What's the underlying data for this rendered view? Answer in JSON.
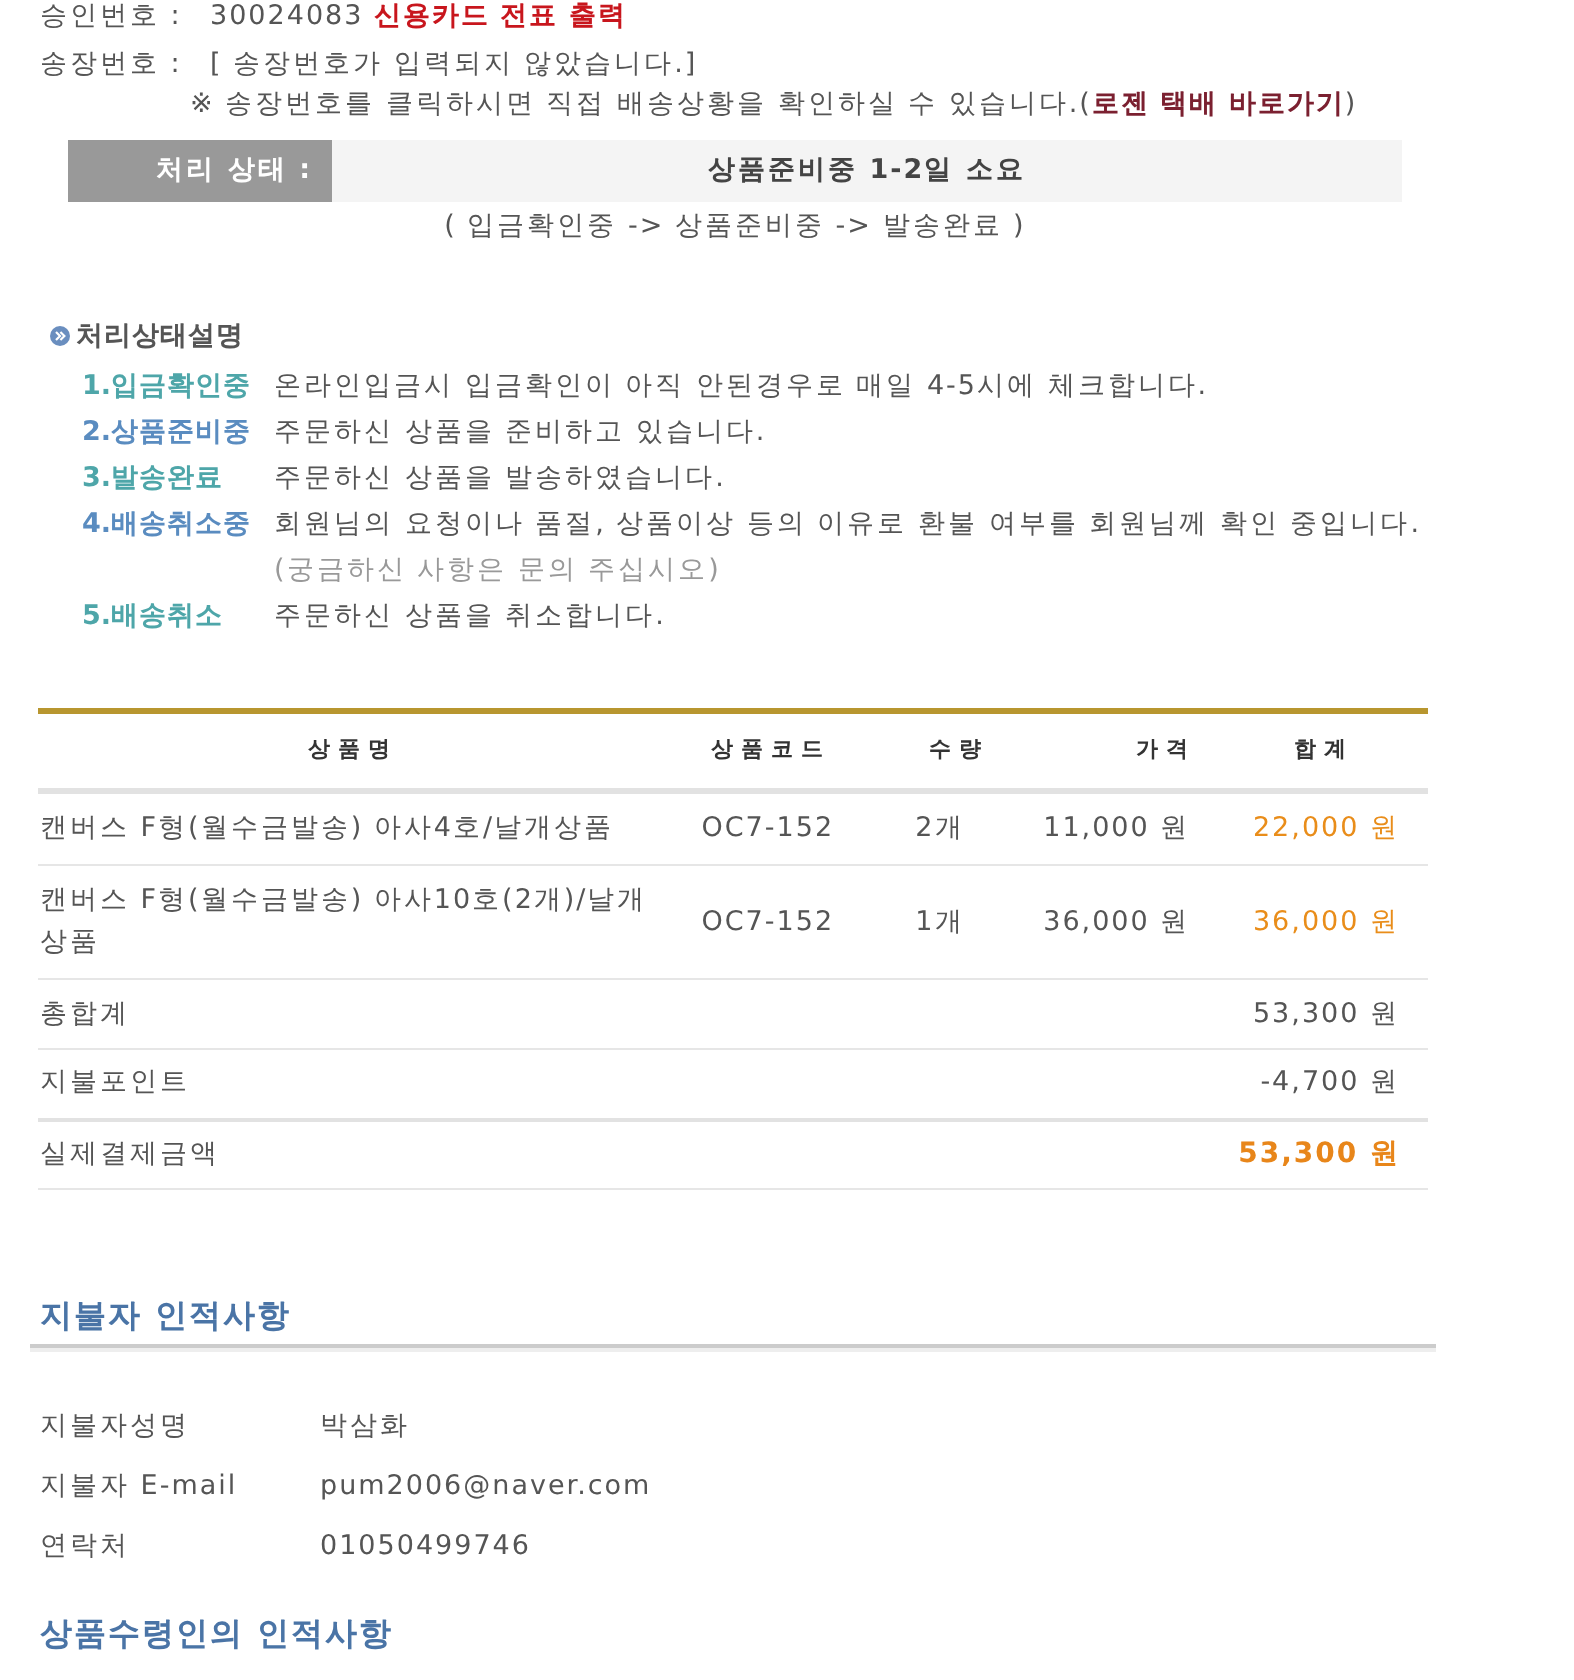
{
  "approval": {
    "label": "승인번호 :",
    "number": "30024083",
    "receipt_link": "신용카드 전표 출력"
  },
  "invoice": {
    "label": "송장번호 :",
    "value": "[ 송장번호가 입력되지 않았습니다.]",
    "note": "※ 송장번호를 클릭하시면 직접 배송상황을 확인하실 수 있습니다.(",
    "courier_link": "로젠 택배 바로가기",
    "note_end": ")"
  },
  "status": {
    "label": "처리 상태 :",
    "value": "상품준비중 1-2일 소요",
    "flow": "( 입금확인중 -> 상품준비중 -> 발송완료 )"
  },
  "status_legend": {
    "title": "처리상태설명",
    "items": [
      {
        "label": "1.입금확인중",
        "color": "#4ea6a9",
        "description": "온라인입금시 입금확인이 아직 안된경우로 매일 4-5시에 체크합니다."
      },
      {
        "label": "2.상품준비중",
        "color": "#5a8cc0",
        "description": "주문하신 상품을 준비하고 있습니다."
      },
      {
        "label": "3.발송완료",
        "color": "#4ea6a9",
        "description": "주문하신 상품을 발송하였습니다."
      },
      {
        "label": "4.배송취소중",
        "color": "#5a8cc0",
        "description": "회원님의 요청이나 품절, 상품이상 등의 이유로 환불 여부를 회원님께 확인 중입니다.",
        "note": "(궁금하신 사항은 문의 주십시오)"
      },
      {
        "label": "5.배송취소",
        "color": "#4ea6a9",
        "description": "주문하신 상품을 취소합니다."
      }
    ]
  },
  "order_table": {
    "columns": [
      "상품명",
      "상품코드",
      "수량",
      "가격",
      "합계"
    ],
    "rows": [
      {
        "name": "캔버스 F형(월수금발송) 아사4호/날개상품",
        "code": "OC7-152",
        "quantity": "2개",
        "price": "11,000 원",
        "total": "22,000 원"
      },
      {
        "name": "캔버스 F형(월수금발송) 아사10호(2개)/날개상품",
        "code": "OC7-152",
        "quantity": "1개",
        "price": "36,000 원",
        "total": "36,000 원"
      }
    ],
    "summary": [
      {
        "kind": "sum",
        "label": "총합계",
        "amount": "53,300 원"
      },
      {
        "kind": "sum",
        "label": "지불포인트",
        "amount": "-4,700 원"
      },
      {
        "kind": "final",
        "label": "실제결제금액",
        "amount": "53,300 원"
      }
    ]
  },
  "payer": {
    "title": "지불자 인적사항",
    "fields": [
      {
        "label": "지불자성명",
        "value": "박삼화"
      },
      {
        "label": "지불자 E-mail",
        "value": "pum2006@naver.com"
      },
      {
        "label": "연락처",
        "value": "01050499746"
      }
    ]
  },
  "recipient": {
    "title": "상품수령인의 인적사항"
  }
}
